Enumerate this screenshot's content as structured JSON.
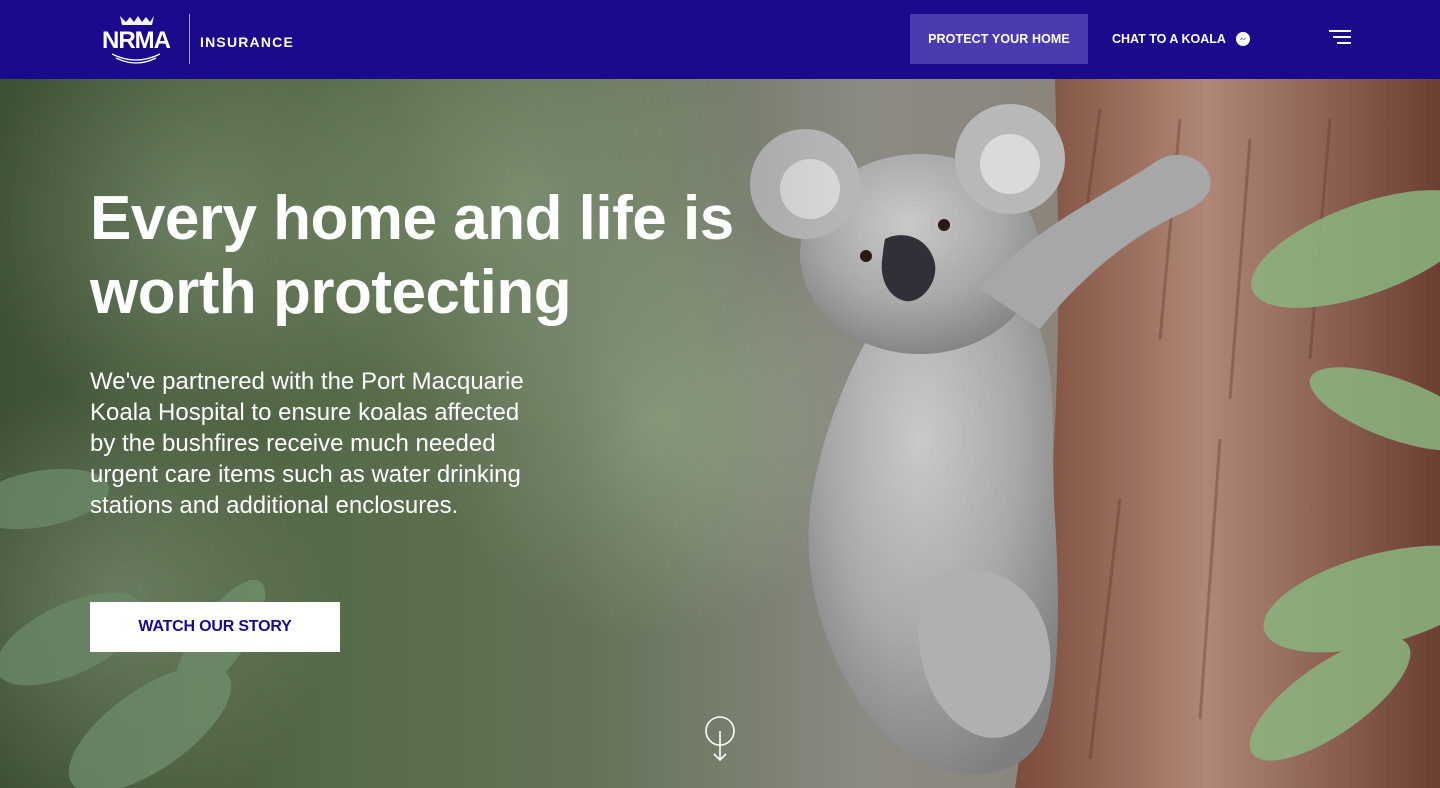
{
  "header": {
    "logo_text": "NRMA",
    "logo_subtitle": "INSURANCE",
    "nav_protect": "PROTECT YOUR HOME",
    "nav_chat": "CHAT TO A KOALA"
  },
  "hero": {
    "headline": "Every home and life is worth protecting",
    "body": "We've partnered with the Port Macquarie Koala Hospital to ensure koalas affected by the bushfires receive much needed urgent care items such as water drinking stations and additional enclosures.",
    "cta": "WATCH OUR STORY"
  },
  "colors": {
    "brand": "#1a0a8c",
    "nav_highlight": "#4b3bb0",
    "cta_bg": "#ffffff"
  },
  "icons": [
    "messenger-icon",
    "hamburger-menu-icon",
    "scroll-down-icon"
  ]
}
